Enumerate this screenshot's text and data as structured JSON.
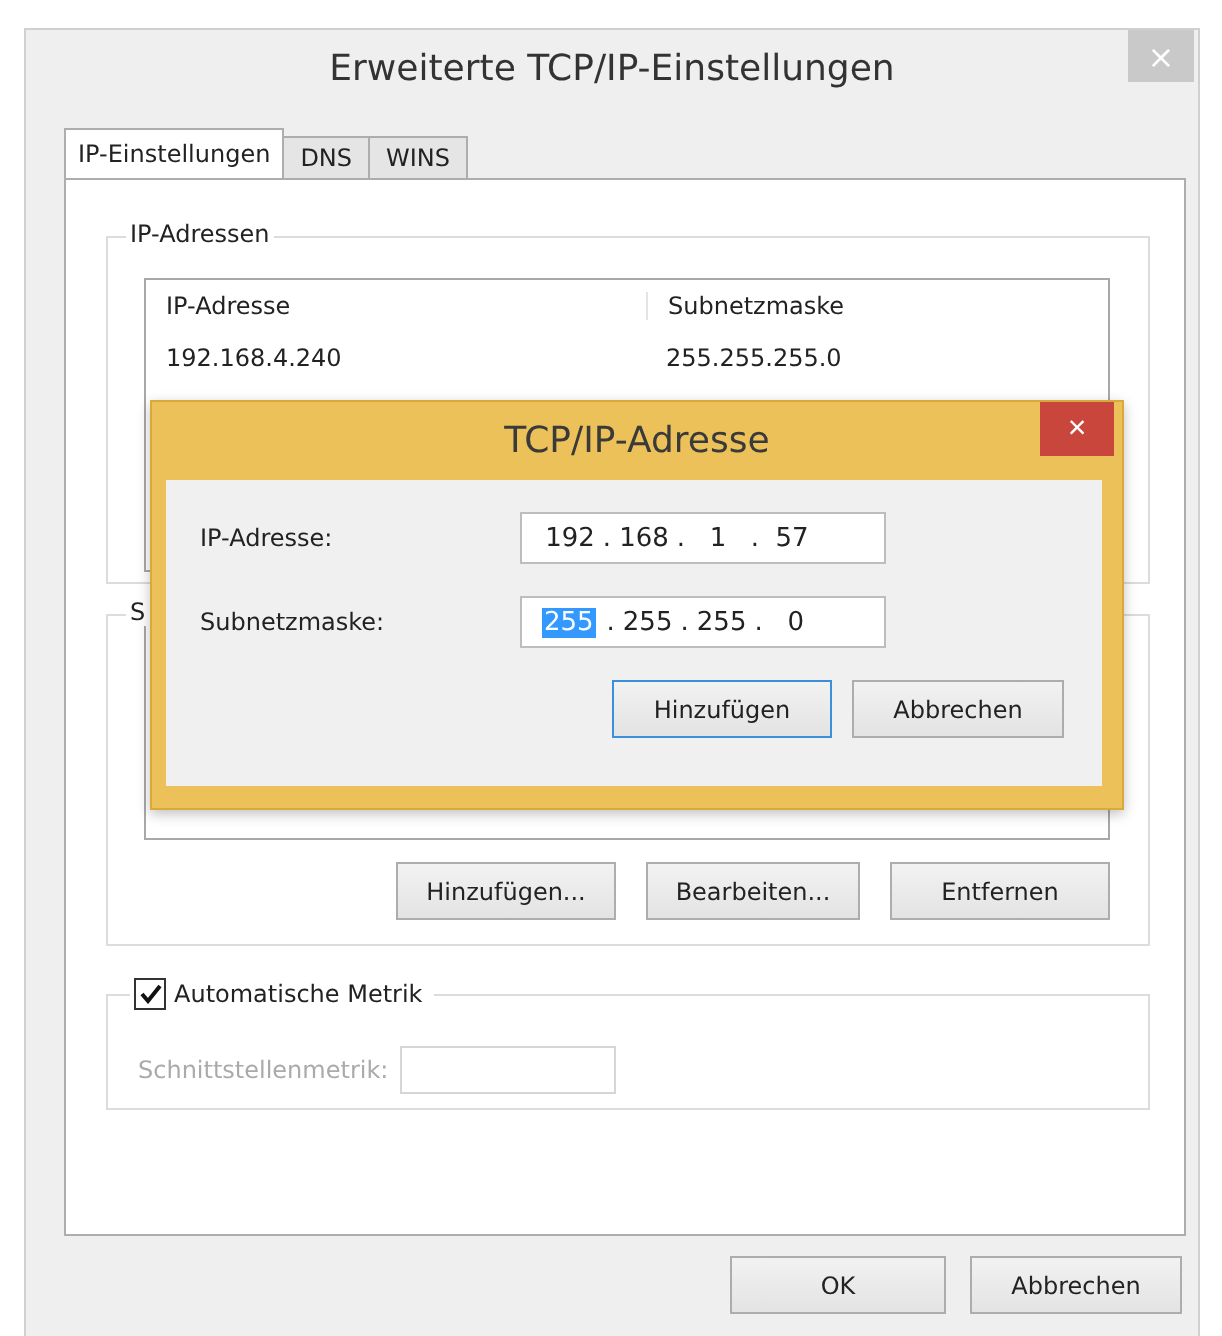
{
  "window": {
    "title": "Erweiterte TCP/IP-Einstellungen",
    "close": "×",
    "close_disabled": true
  },
  "tabs": [
    {
      "label": "IP-Einstellungen",
      "selected": true
    },
    {
      "label": "DNS",
      "selected": false
    },
    {
      "label": "WINS",
      "selected": false
    }
  ],
  "ip_group": {
    "title": "IP-Adressen",
    "columns": [
      "IP-Adresse",
      "Subnetzmaske"
    ],
    "rows": [
      [
        "192.168.4.240",
        "255.255.255.0"
      ]
    ]
  },
  "gateway_group": {
    "title": "S",
    "buttons": [
      "Hinzufügen...",
      "Bearbeiten...",
      "Entfernen"
    ]
  },
  "metric": {
    "label": "Automatische Metrik",
    "checked": true,
    "field_label": "Schnittstellenmetrik:",
    "disabled": true
  },
  "buttons": [
    "OK",
    "Abbrechen"
  ],
  "dialog": {
    "title": "TCP/IP-Adresse",
    "close": "×",
    "fields": [
      {
        "label": "IP-Adresse:",
        "separator": ".",
        "octets": [
          {
            "text": "192",
            "selected": false
          },
          {
            "text": "168",
            "selected": false
          },
          {
            "text": "1",
            "selected": false
          },
          {
            "text": "57",
            "selected": false
          }
        ]
      },
      {
        "label": "Subnetzmaske:",
        "separator": ".",
        "octets": [
          {
            "text": "255",
            "selected": true
          },
          {
            "text": "255",
            "selected": false
          },
          {
            "text": "255",
            "selected": false
          },
          {
            "text": "0",
            "selected": false
          }
        ]
      }
    ],
    "buttons": [
      {
        "label": "Hinzufügen",
        "default": true
      },
      {
        "label": "Abbrechen",
        "default": false
      }
    ]
  }
}
